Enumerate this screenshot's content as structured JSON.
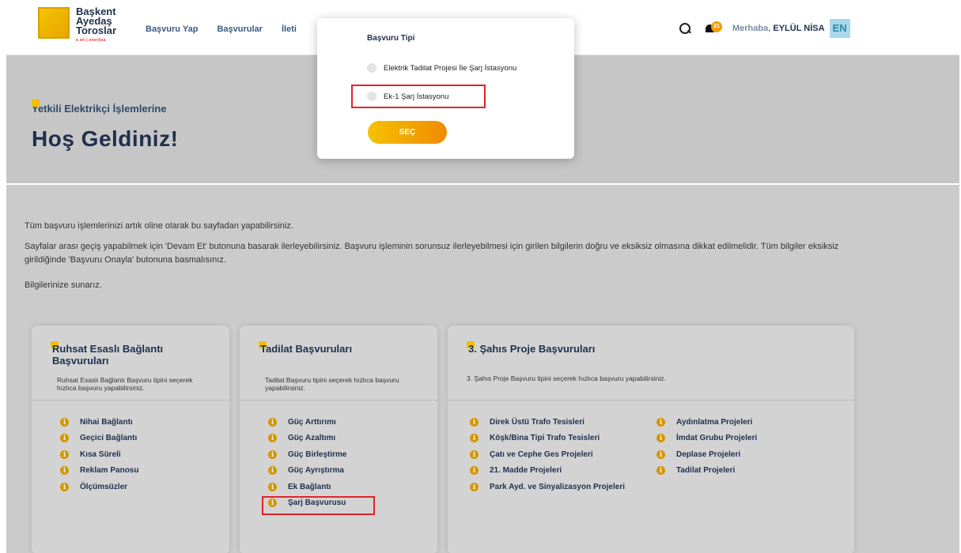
{
  "header": {
    "logo_line1": "Başkent",
    "logo_line2": "Ayedaş",
    "logo_line3": "Toroslar",
    "logo_sub": "e.on | enerjisa",
    "nav": [
      "Başvuru Yap",
      "Başvurular",
      "İleti"
    ],
    "bell_count": "21",
    "greeting_prefix": "Merhaba,",
    "user_name": "EYLÜL NİSA",
    "language": "EN"
  },
  "hero": {
    "subtitle": "Yetkili Elektrikçi İşlemlerine",
    "title": "Hoş Geldiniz!"
  },
  "intro": {
    "p1": "Tüm başvuru işlemlerinizi artık oline olarak bu sayfadan yapabilirsiniz.",
    "p2": "Sayfalar arası geçiş yapabilmek için 'Devam Et' butonuna basarak ilerleyebilirsiniz. Başvuru işleminin sorunsuz ilerleyebilmesi için girilen bilgilerin doğru ve eksiksiz olmasına dikkat edilmelidir. Tüm bilgiler eksiksiz girildiğinde 'Başvuru Onayla' butonuna basmalısınız.",
    "p3": "Bilgilerinize sunarız."
  },
  "cards": {
    "ruhsat": {
      "title": "Ruhsat Esaslı Bağlantı Başvuruları",
      "desc": "Ruhsat Esaslı Bağlantı Başvuru tipini seçerek hızlıca başvuru yapabilirsiniz.",
      "items": [
        "Nihai Bağlantı",
        "Geçici Bağlantı",
        "Kısa Süreli",
        "Reklam Panosu",
        "Ölçümsüzler"
      ]
    },
    "tadilat": {
      "title": "Tadilat Başvuruları",
      "desc": "Tadilat Başvuru tipini seçerek hızlıca başvuru yapabilirsiniz.",
      "items": [
        "Güç Arttırımı",
        "Güç Azaltımı",
        "Güç Birleştirme",
        "Güç Ayrıştırma",
        "Ek Bağlantı",
        "Şarj Başvurusu"
      ]
    },
    "sahis": {
      "title": "3. Şahıs Proje Başvuruları",
      "desc": "3. Şahıs Proje Başvuru tipini seçerek hızlıca başvuru yapabilirsiniz.",
      "items_left": [
        "Direk Üstü Trafo Tesisleri",
        "Köşk/Bina Tipi Trafo Tesisleri",
        "Çatı ve Cephe Ges Projeleri",
        "21. Madde Projeleri",
        "Park Ayd. ve Sinyalizasyon Projeleri"
      ],
      "items_right": [
        "Aydınlatma Projeleri",
        "İmdat Grubu Projeleri",
        "Deplase Projeleri",
        "Tadilat Projeleri"
      ]
    }
  },
  "modal": {
    "title": "Başvuru Tipi",
    "option1": "Elektrik Tadilat Projesi İle Şarj İstasyonu",
    "option2": "Ek-1 Şarj İstasyonu",
    "button": "SEÇ"
  },
  "colors": {
    "accent_yellow": "#f5c400",
    "accent_orange": "#f08a00",
    "navy": "#1f2f4d",
    "highlight_red": "#e0242a"
  }
}
